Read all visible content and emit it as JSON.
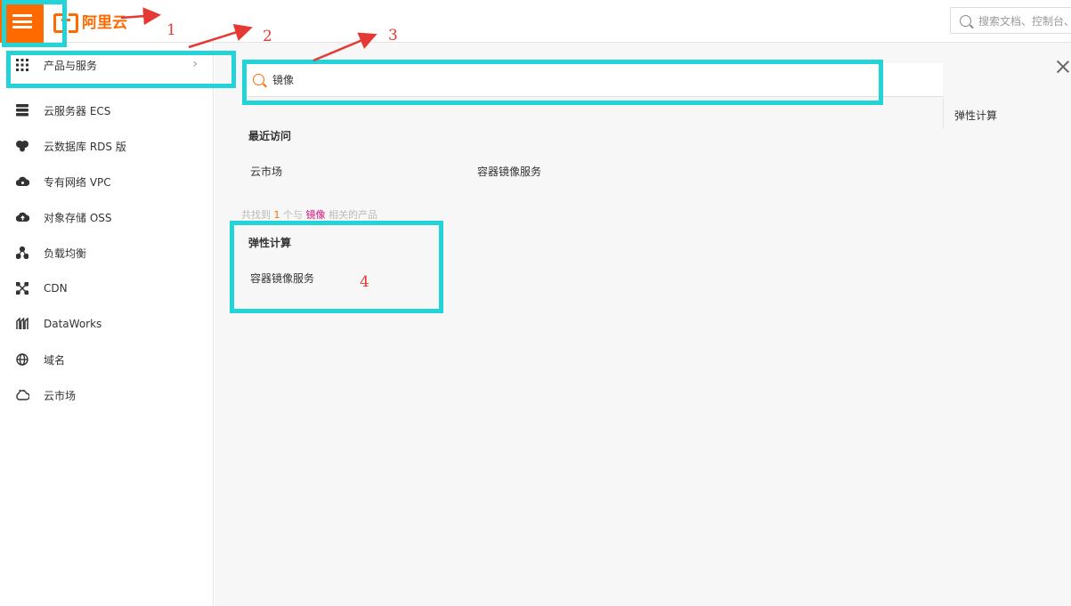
{
  "header": {
    "logo_text": "阿里云",
    "search_placeholder": "搜索文档、控制台、"
  },
  "sidebar": {
    "items": [
      {
        "label": "产品与服务",
        "icon": "grid-icon"
      },
      {
        "label": "云服务器 ECS",
        "icon": "server-icon"
      },
      {
        "label": "云数据库 RDS 版",
        "icon": "database-icon"
      },
      {
        "label": "专有网络 VPC",
        "icon": "cloud-network-icon"
      },
      {
        "label": "对象存储 OSS",
        "icon": "cloud-upload-icon"
      },
      {
        "label": "负载均衡",
        "icon": "nodes-icon"
      },
      {
        "label": "CDN",
        "icon": "cdn-icon"
      },
      {
        "label": "DataWorks",
        "icon": "dataworks-icon"
      },
      {
        "label": "域名",
        "icon": "globe-icon"
      },
      {
        "label": "云市场",
        "icon": "market-icon"
      }
    ]
  },
  "search": {
    "value": "镜像"
  },
  "right_panel": {
    "category": "弹性计算"
  },
  "recent": {
    "title": "最近访问",
    "items": [
      "云市场",
      "容器镜像服务"
    ]
  },
  "results": {
    "prefix": "共找到",
    "count": "1",
    "middle": "个与",
    "keyword": "镜像",
    "suffix": "相关的产品",
    "category": "弹性计算",
    "items": [
      "容器镜像服务"
    ]
  },
  "annotations": {
    "labels": [
      "1",
      "2",
      "3",
      "4"
    ],
    "box_color": "#22d3d8",
    "arrow_color": "#e53935"
  },
  "colors": {
    "brand": "#ff6a00"
  }
}
